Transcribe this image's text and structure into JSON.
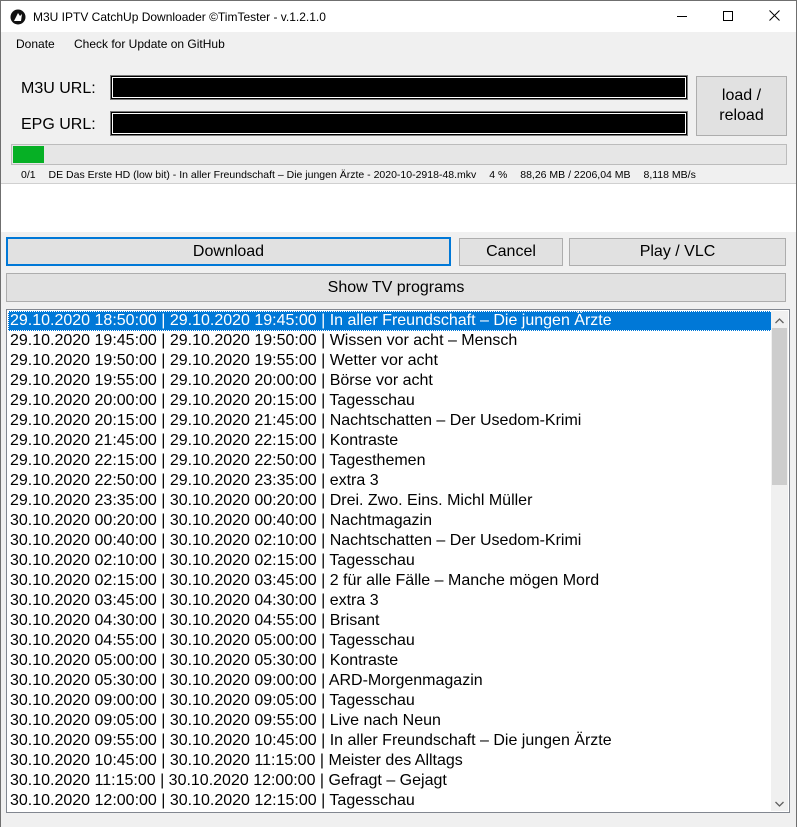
{
  "window": {
    "title": "M3U IPTV CatchUp Downloader ©TimTester - v.1.2.1.0",
    "icons": {
      "app": "app-icon",
      "minimize": "minimize-icon",
      "maximize": "maximize-icon",
      "close": "close-icon"
    }
  },
  "menu": {
    "items": [
      "Donate",
      "Check for Update on GitHub"
    ]
  },
  "form": {
    "m3u_label": "M3U URL:",
    "epg_label": "EPG URL:",
    "m3u_value": "",
    "epg_value": "",
    "load_button": "load / reload"
  },
  "download": {
    "progress_percent": 4,
    "count": "0/1",
    "file": "DE Das Erste HD (low bit) - In aller Freundschaft – Die jungen Ärzte - 2020-10-2918-48.mkv",
    "percent_text": "4 %",
    "size_text": "88,26 MB / 2206,04 MB",
    "speed_text": "8,118 MB/s",
    "progress_color": "#06b025"
  },
  "buttons": {
    "download": "Download",
    "cancel": "Cancel",
    "play": "Play / VLC",
    "show_programs": "Show TV programs"
  },
  "programs": {
    "selected_index": 0,
    "selection_color": "#0078d7",
    "items": [
      "29.10.2020 18:50:00 | 29.10.2020 19:45:00 | In aller Freundschaft – Die jungen Ärzte",
      "29.10.2020 19:45:00 | 29.10.2020 19:50:00 | Wissen vor acht – Mensch",
      "29.10.2020 19:50:00 | 29.10.2020 19:55:00 | Wetter vor acht",
      "29.10.2020 19:55:00 | 29.10.2020 20:00:00 | Börse vor acht",
      "29.10.2020 20:00:00 | 29.10.2020 20:15:00 | Tagesschau",
      "29.10.2020 20:15:00 | 29.10.2020 21:45:00 | Nachtschatten – Der Usedom-Krimi",
      "29.10.2020 21:45:00 | 29.10.2020 22:15:00 | Kontraste",
      "29.10.2020 22:15:00 | 29.10.2020 22:50:00 | Tagesthemen",
      "29.10.2020 22:50:00 | 29.10.2020 23:35:00 | extra 3",
      "29.10.2020 23:35:00 | 30.10.2020 00:20:00 | Drei. Zwo. Eins. Michl Müller",
      "30.10.2020 00:20:00 | 30.10.2020 00:40:00 | Nachtmagazin",
      "30.10.2020 00:40:00 | 30.10.2020 02:10:00 | Nachtschatten – Der Usedom-Krimi",
      "30.10.2020 02:10:00 | 30.10.2020 02:15:00 | Tagesschau",
      "30.10.2020 02:15:00 | 30.10.2020 03:45:00 | 2 für alle Fälle – Manche mögen Mord",
      "30.10.2020 03:45:00 | 30.10.2020 04:30:00 | extra 3",
      "30.10.2020 04:30:00 | 30.10.2020 04:55:00 | Brisant",
      "30.10.2020 04:55:00 | 30.10.2020 05:00:00 | Tagesschau",
      "30.10.2020 05:00:00 | 30.10.2020 05:30:00 | Kontraste",
      "30.10.2020 05:30:00 | 30.10.2020 09:00:00 | ARD-Morgenmagazin",
      "30.10.2020 09:00:00 | 30.10.2020 09:05:00 | Tagesschau",
      "30.10.2020 09:05:00 | 30.10.2020 09:55:00 | Live nach Neun",
      "30.10.2020 09:55:00 | 30.10.2020 10:45:00 | In aller Freundschaft – Die jungen Ärzte",
      "30.10.2020 10:45:00 | 30.10.2020 11:15:00 | Meister des Alltags",
      "30.10.2020 11:15:00 | 30.10.2020 12:00:00 | Gefragt – Gejagt",
      "30.10.2020 12:00:00 | 30.10.2020 12:15:00 | Tagesschau"
    ]
  }
}
